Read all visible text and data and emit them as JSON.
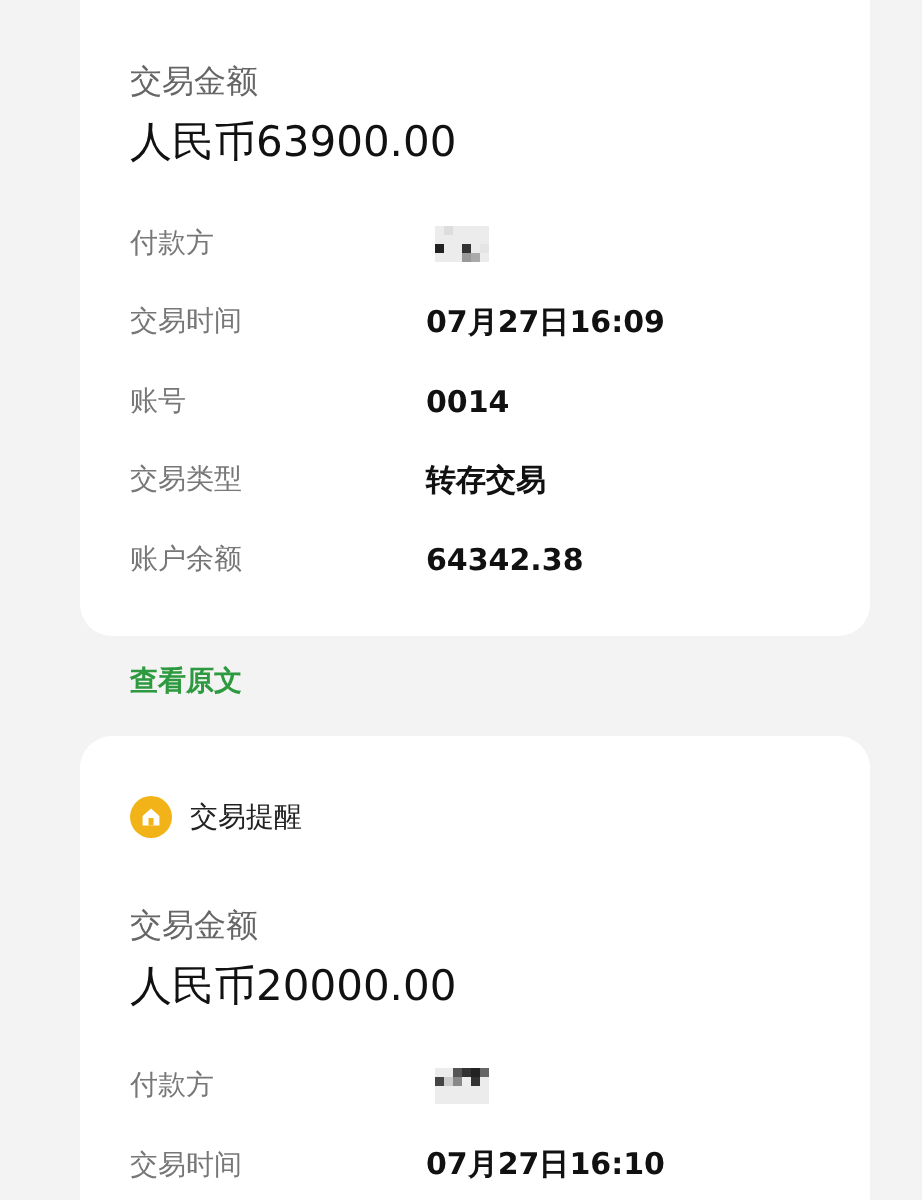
{
  "cards": [
    {
      "amount_label": "交易金额",
      "amount": "人民币63900.00",
      "rows": [
        {
          "label": "付款方",
          "kind": "redacted"
        },
        {
          "label": "交易时间",
          "kind": "text",
          "value": "07月27日16:09"
        },
        {
          "label": "账号",
          "kind": "text",
          "value": "0014"
        },
        {
          "label": "交易类型",
          "kind": "text",
          "value": "转存交易"
        },
        {
          "label": "账户余额",
          "kind": "text",
          "value": "64342.38"
        }
      ],
      "link": "查看原文"
    },
    {
      "header": "交易提醒",
      "amount_label": "交易金额",
      "amount": "人民币20000.00",
      "rows": [
        {
          "label": "付款方",
          "kind": "redacted"
        },
        {
          "label": "交易时间",
          "kind": "text",
          "value": "07月27日16:10"
        }
      ]
    }
  ]
}
